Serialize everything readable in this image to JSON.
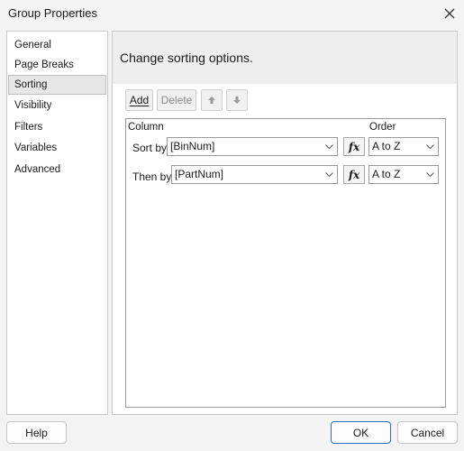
{
  "window": {
    "title": "Group Properties",
    "close_icon": "close-icon"
  },
  "nav": {
    "items": [
      {
        "label": "General"
      },
      {
        "label": "Page Breaks"
      },
      {
        "label": "Sorting",
        "active": true
      },
      {
        "label": "Visibility"
      },
      {
        "label": "Filters"
      },
      {
        "label": "Variables"
      },
      {
        "label": "Advanced"
      }
    ]
  },
  "panel": {
    "title": "Change sorting options."
  },
  "toolbar": {
    "add_label": "Add",
    "delete_label": "Delete",
    "move_up_icon": "arrow-up-icon",
    "move_down_icon": "arrow-down-icon"
  },
  "grid": {
    "column_header": "Column",
    "order_header": "Order",
    "rows": [
      {
        "label": "Sort by",
        "column": "[BinNum]",
        "order": "A to Z"
      },
      {
        "label": "Then by",
        "column": "[PartNum]",
        "order": "A to Z"
      }
    ],
    "fx_label": "fx"
  },
  "footer": {
    "help_label": "Help",
    "ok_label": "OK",
    "cancel_label": "Cancel"
  }
}
